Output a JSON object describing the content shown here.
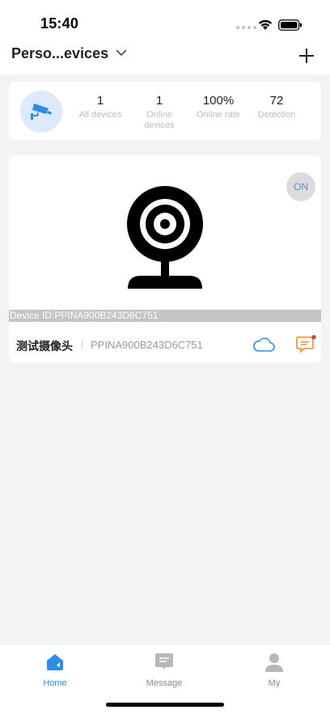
{
  "status_bar": {
    "time": "15:40"
  },
  "header": {
    "title": "Perso...evices"
  },
  "summary": {
    "stats": [
      {
        "value": "1",
        "label": "All devices"
      },
      {
        "value": "1",
        "label": "Online devices"
      },
      {
        "value": "100%",
        "label": "Online rate"
      },
      {
        "value": "72",
        "label": "Detection"
      }
    ]
  },
  "device": {
    "status": "ON",
    "id_text": "Device ID:PPINA900B243D6C751",
    "name": "测试摄像头",
    "serial": "PPINA900B243D6C751"
  },
  "tabbar": {
    "tabs": [
      {
        "label": "Home",
        "color": "#2e8de6"
      },
      {
        "label": "Message",
        "color": "#8a8a8a"
      },
      {
        "label": "My",
        "color": "#8a8a8a"
      }
    ]
  }
}
